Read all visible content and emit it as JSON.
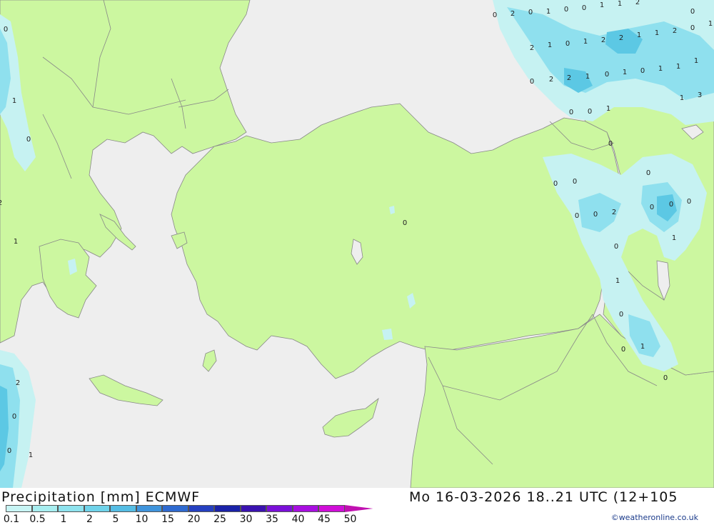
{
  "map": {
    "colors": {
      "sea": "#eeeeee",
      "land": "#ccf7a0",
      "border": "#888888",
      "precip_light": "#c6f2f2",
      "precip_mid": "#8fe0ee",
      "precip_heavy": "#5cc8e4"
    },
    "labels": [
      {
        "v": "0"
      },
      {
        "v": "2"
      },
      {
        "v": "0"
      },
      {
        "v": "1"
      },
      {
        "v": "0"
      },
      {
        "v": "0"
      },
      {
        "v": "1"
      },
      {
        "v": "1"
      },
      {
        "v": "2"
      },
      {
        "v": "0"
      },
      {
        "v": "1"
      },
      {
        "v": "2"
      },
      {
        "v": "1"
      },
      {
        "v": "0"
      },
      {
        "v": "1"
      },
      {
        "v": "2"
      },
      {
        "v": "2"
      },
      {
        "v": "1"
      },
      {
        "v": "1"
      },
      {
        "v": "2"
      },
      {
        "v": "0"
      },
      {
        "v": "0"
      },
      {
        "v": "2"
      },
      {
        "v": "2"
      },
      {
        "v": "1"
      },
      {
        "v": "0"
      },
      {
        "v": "1"
      },
      {
        "v": "0"
      },
      {
        "v": "1"
      },
      {
        "v": "1"
      },
      {
        "v": "1"
      },
      {
        "v": "3"
      },
      {
        "v": "1"
      },
      {
        "v": "0"
      },
      {
        "v": "1"
      },
      {
        "v": "0"
      },
      {
        "v": "0"
      },
      {
        "v": "0"
      },
      {
        "v": "0"
      },
      {
        "v": "0"
      },
      {
        "v": "0"
      },
      {
        "v": "0"
      },
      {
        "v": "2"
      },
      {
        "v": "0"
      },
      {
        "v": "0"
      },
      {
        "v": "0"
      },
      {
        "v": "1"
      },
      {
        "v": "0"
      },
      {
        "v": "1"
      },
      {
        "v": "0"
      },
      {
        "v": "0"
      },
      {
        "v": "1"
      },
      {
        "v": "0"
      },
      {
        "v": "0"
      },
      {
        "v": "0"
      },
      {
        "v": "1"
      },
      {
        "v": "0"
      },
      {
        "v": "2"
      },
      {
        "v": "1"
      },
      {
        "v": "2"
      },
      {
        "v": "0"
      },
      {
        "v": "0"
      },
      {
        "v": "1"
      }
    ]
  },
  "footer": {
    "title": "Precipitation [mm] ECMWF",
    "valid_time": "Mo 16-03-2026 18..21 UTC (12+105",
    "credit": "©weatheronline.co.uk"
  },
  "legend": {
    "ticks": [
      "0.1",
      "0.5",
      "1",
      "2",
      "5",
      "10",
      "15",
      "20",
      "25",
      "30",
      "35",
      "40",
      "45",
      "50"
    ],
    "colors": [
      "#c8f5f5",
      "#a8eef0",
      "#8ee3ee",
      "#6fd3ea",
      "#55bde4",
      "#3f94dc",
      "#2f6ad0",
      "#2540c0",
      "#1a22a8",
      "#3a12b0",
      "#7a10d8",
      "#a80ee0",
      "#d00ed8",
      "#c010b0"
    ]
  }
}
